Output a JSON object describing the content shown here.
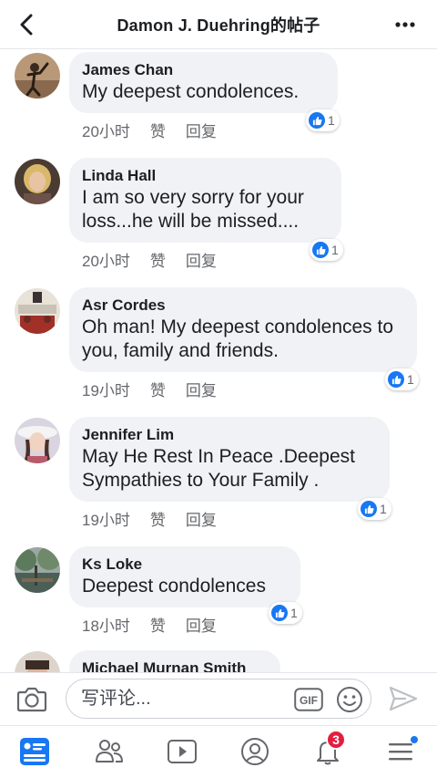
{
  "header": {
    "title": "Damon J. Duehring的帖子"
  },
  "comments": [
    {
      "author": "James Chan",
      "text": "My deepest condolences.",
      "time": "20小时",
      "like_label": "赞",
      "reply_label": "回复",
      "reaction_count": "1"
    },
    {
      "author": "Linda Hall",
      "text": "I am so very sorry for your loss...he will be missed....",
      "time": "20小时",
      "like_label": "赞",
      "reply_label": "回复",
      "reaction_count": "1"
    },
    {
      "author": "Asr Cordes",
      "text": "Oh man! My deepest condolences to you, family and friends.",
      "time": "19小时",
      "like_label": "赞",
      "reply_label": "回复",
      "reaction_count": "1"
    },
    {
      "author": "Jennifer Lim",
      "text": "May He Rest In Peace .Deepest Sympathies to Your Family .",
      "time": "19小时",
      "like_label": "赞",
      "reply_label": "回复",
      "reaction_count": "1"
    },
    {
      "author": "Ks Loke",
      "text": "Deepest condolences",
      "time": "18小时",
      "like_label": "赞",
      "reply_label": "回复",
      "reaction_count": "1"
    },
    {
      "author": "Michael Murnan Smith"
    }
  ],
  "composer": {
    "placeholder": "写评论...",
    "gif_label": "GIF"
  },
  "tabbar": {
    "notification_count": "3"
  },
  "colors": {
    "brand_blue": "#1877f2",
    "bubble_bg": "#f0f2f5",
    "badge_red": "#e41e3f",
    "meta_gray": "#65676b"
  },
  "icons": [
    "back-arrow-icon",
    "more-dots-icon",
    "like-thumb-icon",
    "camera-icon",
    "gif-icon",
    "emoji-icon",
    "send-icon",
    "news-feed-icon",
    "friends-icon",
    "watch-icon",
    "profile-icon",
    "bell-icon",
    "menu-icon"
  ]
}
